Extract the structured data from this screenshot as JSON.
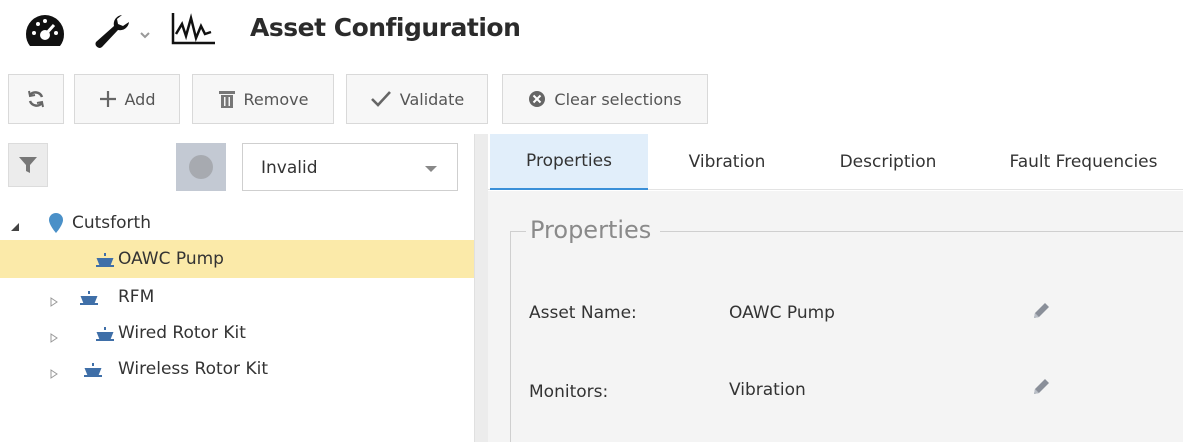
{
  "header": {
    "title": "Asset Configuration",
    "icons": [
      "dashboard-icon",
      "wrench-icon",
      "waveform-icon"
    ]
  },
  "toolbar": {
    "refresh_icon": "refresh-icon",
    "add_label": "Add",
    "remove_label": "Remove",
    "validate_label": "Validate",
    "clear_label": "Clear selections"
  },
  "filter": {
    "selected": "Invalid"
  },
  "tree": {
    "root": {
      "label": "Cutsforth",
      "icon": "map-pin-icon"
    },
    "items": [
      {
        "label": "OAWC Pump",
        "selected": true,
        "expandable": false
      },
      {
        "label": "RFM",
        "selected": false,
        "expandable": true
      },
      {
        "label": "Wired Rotor Kit",
        "selected": false,
        "expandable": true
      },
      {
        "label": "Wireless Rotor Kit",
        "selected": false,
        "expandable": true
      }
    ]
  },
  "tabs": [
    {
      "label": "Properties",
      "active": true
    },
    {
      "label": "Vibration",
      "active": false
    },
    {
      "label": "Description",
      "active": false
    },
    {
      "label": "Fault Frequencies",
      "active": false
    }
  ],
  "properties": {
    "legend": "Properties",
    "fields": [
      {
        "label": "Asset Name:",
        "value": "OAWC Pump"
      },
      {
        "label": "Monitors:",
        "value": "Vibration"
      }
    ]
  },
  "colors": {
    "selected_row": "#fbeaa9",
    "active_tab": "#e1eefa",
    "accent": "#3a8fd8",
    "pin": "#4a90c8",
    "edit_icon": "#8a8f99"
  }
}
